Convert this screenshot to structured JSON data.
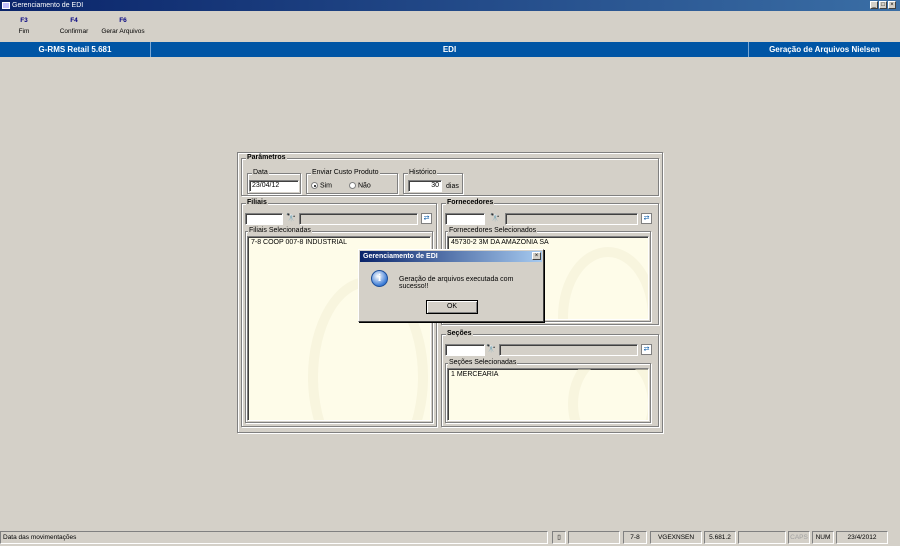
{
  "window": {
    "title": "Gerenciamento de EDI"
  },
  "toolbar": {
    "items": [
      {
        "key": "F3",
        "label": "Fim"
      },
      {
        "key": "F4",
        "label": "Confirmar"
      },
      {
        "key": "F6",
        "label": "Gerar Arquivos"
      }
    ]
  },
  "header": {
    "product": "G-RMS Retail 5.681",
    "module": "EDI",
    "screen": "Geração de Arquivos Nielsen"
  },
  "parametros": {
    "title": "Parâmetros",
    "data_label": "Data",
    "data_value": "23/04/12",
    "custo_label": "Enviar Custo Produto",
    "custo_sim": "Sim",
    "custo_nao": "Não",
    "custo_selected": "Sim",
    "historico_label": "Histórico",
    "historico_value": "30",
    "historico_unit": "dias"
  },
  "filiais": {
    "title": "Filiais",
    "list_label": "Filiais Selecionadas",
    "items": [
      "7-8 COOP 007-8  INDUSTRIAL"
    ]
  },
  "fornecedores": {
    "title": "Fornecedores",
    "list_label": "Fornecedores Selecionados",
    "items": [
      "45730-2 3M DA AMAZONIA SA"
    ]
  },
  "secoes": {
    "title": "Seções",
    "list_label": "Seções Selecionadas",
    "items": [
      "1 MERCEARIA"
    ]
  },
  "dialog": {
    "title": "Gerenciamento de EDI",
    "message": "Geração de arquivos executada com sucesso!!",
    "ok_label": "OK",
    "icon": "info-icon"
  },
  "statusbar": {
    "message": "Data das movimentações",
    "filial": "7-8",
    "program": "VGEXNSEN",
    "version": "5.681.2",
    "caps": "CAPS",
    "num": "NUM",
    "date": "23/4/2012"
  },
  "colors": {
    "header_bg": "#0055a5",
    "titlebar_bg": "#0a246a",
    "list_bg": "#fefce9",
    "window_bg": "#d4d0c8"
  }
}
